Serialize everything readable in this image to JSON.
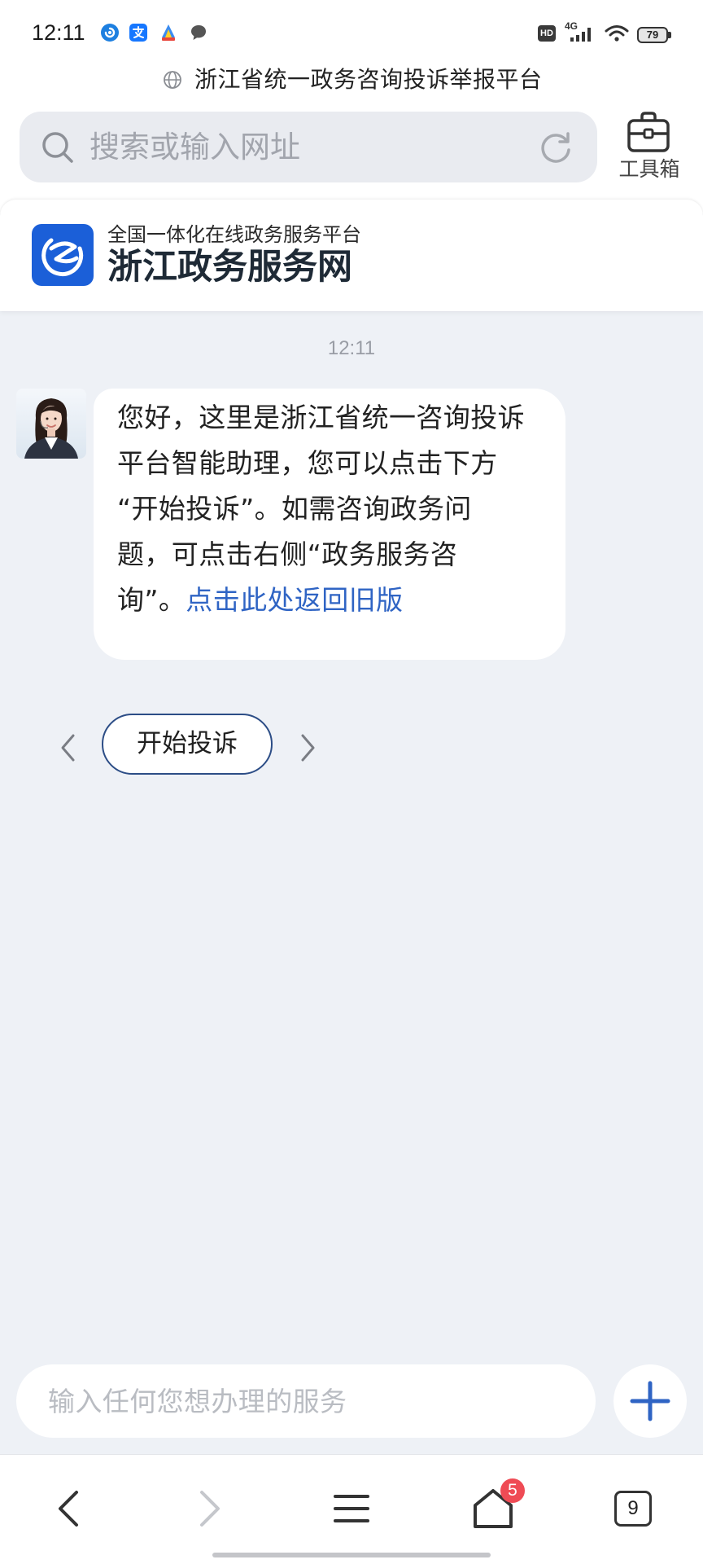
{
  "status_bar": {
    "time": "12:11",
    "notification_icons": [
      "app-icon",
      "alipay-icon",
      "store-app-icon",
      "message-icon"
    ],
    "hd_label": "HD",
    "network_label": "4G",
    "battery_level": "79",
    "system_icons": [
      "signal-icon",
      "wifi-icon",
      "battery-icon"
    ]
  },
  "browser": {
    "page_title": "浙江省统一政务咨询投诉举报平台",
    "title_icon": "globe-icon",
    "address_placeholder": "搜索或输入网址",
    "search_icon": "search-icon",
    "reload_icon": "refresh-icon",
    "toolbox_icon": "toolbox-icon",
    "toolbox_label": "工具箱"
  },
  "site_header": {
    "logo_icon": "site-logo-icon",
    "subtitle": "全国一体化在线政务服务平台",
    "title": "浙江政务服务网"
  },
  "chat": {
    "timestamp": "12:11",
    "message": {
      "lines": [
        "您好，这里是浙江省统一咨询投诉",
        "平台智能助理，您可以点击下方",
        "“开始投诉”。如需咨询政务问",
        "题，可点击右侧“政务服务咨"
      ],
      "last_line_text": "询”。",
      "link_text": "点击此处返回旧版"
    },
    "quick_reply_prev_icon": "chevron-left-icon",
    "quick_replies": [
      "开始投诉"
    ],
    "quick_reply_next_icon": "chevron-right-icon",
    "input_placeholder": "输入任何您想办理的服务",
    "add_icon": "plus-icon"
  },
  "bottom_nav": {
    "items": [
      "back-icon",
      "forward-icon",
      "menu-icon",
      "home-icon",
      "tabs-icon"
    ],
    "home_badge": "5",
    "tab_count": "9"
  },
  "colors": {
    "accent": "#2f64c4",
    "logo_blue": "#1b5fd8",
    "chat_background": "#eef1f6",
    "badge_red": "#ef4b55",
    "quick_reply_border": "#2c4d86"
  }
}
